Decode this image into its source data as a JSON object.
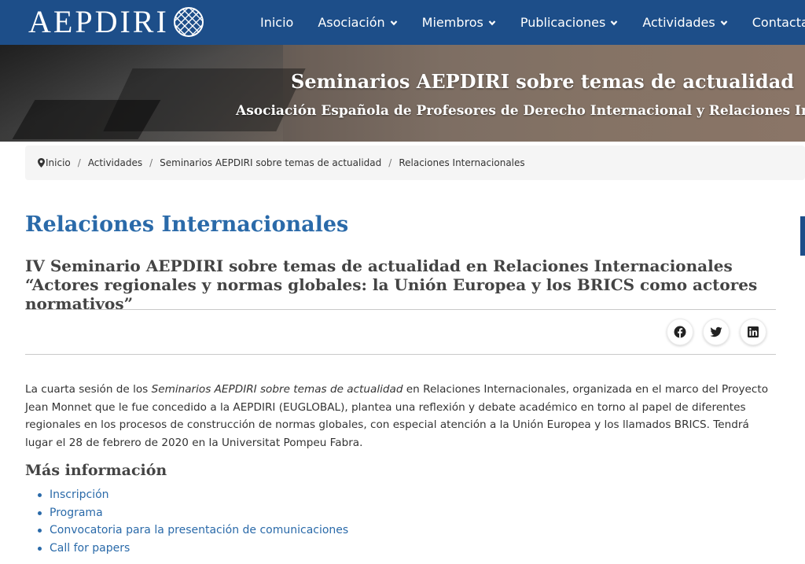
{
  "header": {
    "logo_text": "AEPDIRI",
    "nav": [
      {
        "label": "Inicio",
        "has_dropdown": false
      },
      {
        "label": "Asociación",
        "has_dropdown": true
      },
      {
        "label": "Miembros",
        "has_dropdown": true
      },
      {
        "label": "Publicaciones",
        "has_dropdown": true
      },
      {
        "label": "Actividades",
        "has_dropdown": true
      },
      {
        "label": "Contactar",
        "has_dropdown": true
      }
    ]
  },
  "hero": {
    "title": "Seminarios AEPDIRI sobre temas de actualidad",
    "subtitle": "Asociación Española de Profesores de Derecho Internacional y Relaciones Internacionales"
  },
  "breadcrumb": {
    "items": [
      "Inicio",
      "Actividades",
      "Seminarios AEPDIRI sobre temas de actualidad"
    ],
    "current": "Relaciones Internacionales"
  },
  "main": {
    "page_title": "Relaciones Internacionales",
    "article_title": "IV Seminario AEPDIRI sobre temas de actualidad en Relaciones Internacionales “Actores regionales y normas globales: la Unión Europea y los BRICS como actores normativos”",
    "share": [
      "facebook-icon",
      "twitter-icon",
      "linkedin-icon"
    ],
    "body": {
      "pre": "La cuarta sesión de los ",
      "em": "Seminarios AEPDIRI sobre temas de actualidad",
      "post": " en Relaciones Internacionales, organizada en el marco del Proyecto Jean Monnet que le fue concedido a la AEPDIRI (EUGLOBAL), plantea una reflexión y debate académico en torno al papel de diferentes regionales en los procesos de construcción de normas globales, con especial atención a la Unión Europea y los llamados BRICS. Tendrá lugar el 28 de febrero de 2020 en la Universitat Pompeu Fabra."
    },
    "more_heading": "Más información",
    "links": [
      "Inscripción",
      "Programa",
      "Convocatoria para la presentación de comunicaciones",
      "Call for papers"
    ]
  },
  "colors": {
    "navbar": "#1d4e89",
    "link": "#2a6aa9",
    "heading": "#2a6aa9"
  }
}
